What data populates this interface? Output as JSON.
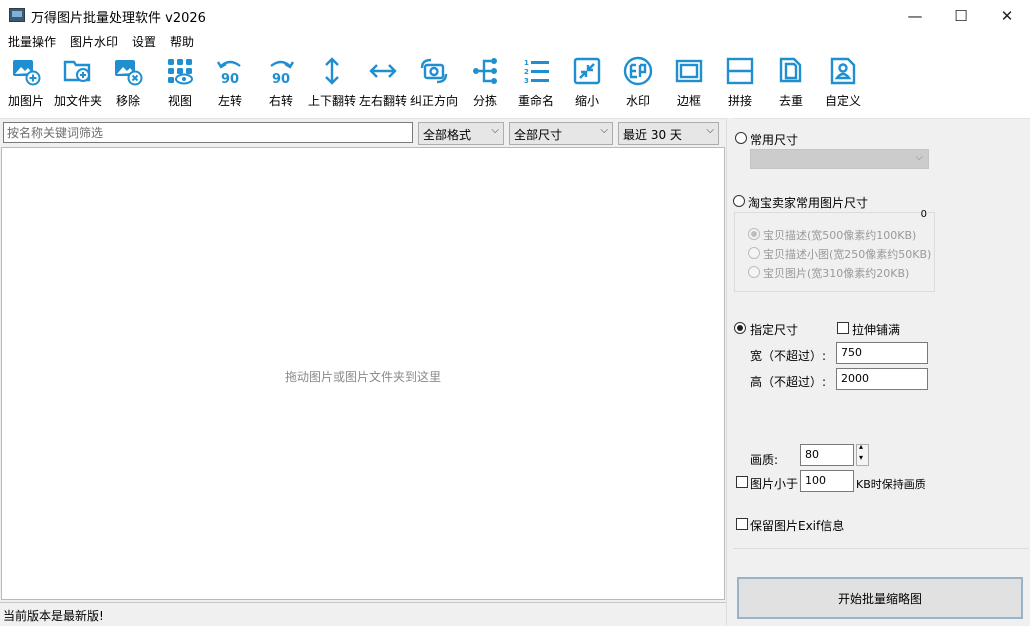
{
  "window": {
    "title": "万得图片批量处理软件 v2026",
    "minimize": "—",
    "maximize": "☐",
    "close": "✕"
  },
  "menu": [
    "批量操作",
    "图片水印",
    "设置",
    "帮助"
  ],
  "toolbar": [
    {
      "label": "加图片",
      "icon": "add-image-icon"
    },
    {
      "label": "加文件夹",
      "icon": "add-folder-icon"
    },
    {
      "label": "移除",
      "icon": "remove-icon"
    },
    {
      "label": "视图",
      "icon": "view-icon"
    },
    {
      "label": "左转",
      "icon": "rotate-left-icon"
    },
    {
      "label": "右转",
      "icon": "rotate-right-icon"
    },
    {
      "label": "上下翻转",
      "icon": "flip-vertical-icon"
    },
    {
      "label": "左右翻转",
      "icon": "flip-horizontal-icon"
    },
    {
      "label": "纠正方向",
      "icon": "correct-orientation-icon"
    },
    {
      "label": "分拣",
      "icon": "sort-icon"
    },
    {
      "label": "重命名",
      "icon": "rename-icon"
    },
    {
      "label": "缩小",
      "icon": "shrink-icon"
    },
    {
      "label": "水印",
      "icon": "watermark-icon"
    },
    {
      "label": "边框",
      "icon": "border-icon"
    },
    {
      "label": "拼接",
      "icon": "stitch-icon"
    },
    {
      "label": "去重",
      "icon": "dedupe-icon"
    },
    {
      "label": "自定义",
      "icon": "custom-icon"
    }
  ],
  "rotate_glyph": "90",
  "filters": {
    "search_placeholder": "按名称关键词筛选",
    "format": "全部格式",
    "size": "全部尺寸",
    "date": "最近 30 天"
  },
  "drop_hint": "拖动图片或图片文件夹到这里",
  "panel": {
    "common_size_label": "常用尺寸",
    "common_size_value": "",
    "taobao_label": "淘宝卖家常用图片尺寸",
    "taobao_group_badge": "0",
    "taobao_options": [
      "宝贝描述(宽500像素约100KB)",
      "宝贝描述小图(宽250像素约50KB)",
      "宝贝图片(宽310像素约20KB)"
    ],
    "specified_label": "指定尺寸",
    "stretch_label": "拉伸铺满",
    "width_label": "宽（不超过）:",
    "width_value": "750",
    "height_label": "高（不超过）:",
    "height_value": "2000",
    "quality_label": "画质:",
    "quality_value": "80",
    "keep_quality_prefix": "图片小于",
    "keep_quality_value": "100",
    "keep_quality_suffix": "KB时保持画质",
    "exif_label": "保留图片Exif信息",
    "start_button": "开始批量缩略图"
  },
  "status": "当前版本是最新版!",
  "colors": {
    "accent": "#1f8fd0"
  }
}
